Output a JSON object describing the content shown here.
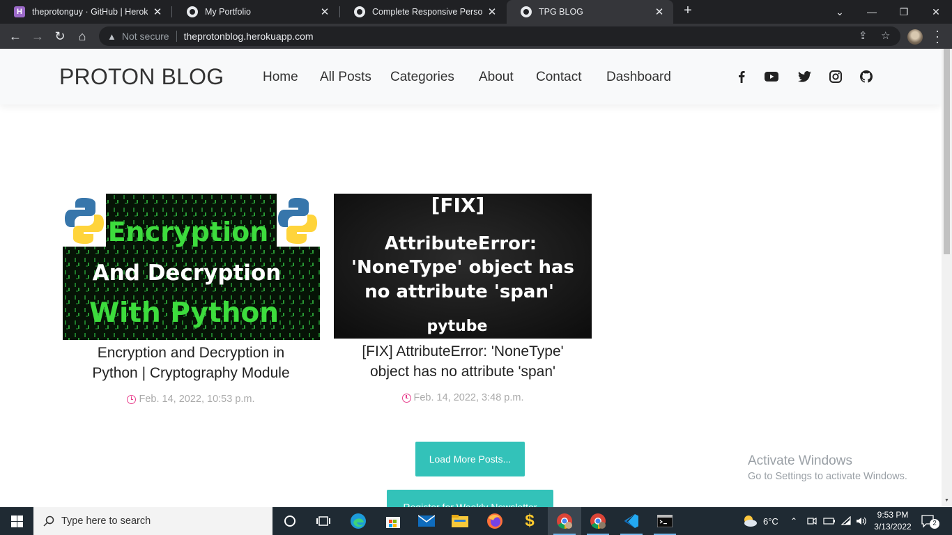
{
  "browser": {
    "tabs": [
      {
        "title": "theprotonguy · GitHub | Heroku",
        "favicon": "heroku-icon"
      },
      {
        "title": "My Portfolio",
        "favicon": "globe-icon"
      },
      {
        "title": "Complete Responsive Personal Po",
        "favicon": "globe-icon"
      },
      {
        "title": "TPG BLOG",
        "favicon": "globe-icon",
        "active": true
      }
    ],
    "security_label": "Not secure",
    "url": "theprotonblog.herokuapp.com"
  },
  "site": {
    "brand": "PROTON BLOG",
    "nav": [
      "Home",
      "All Posts",
      "Categories",
      "About",
      "Contact",
      "Dashboard"
    ],
    "social": [
      "facebook-icon",
      "youtube-icon",
      "twitter-icon",
      "instagram-icon",
      "github-icon"
    ]
  },
  "posts": [
    {
      "title_line1": "Encryption and Decryption in",
      "title_line2": "Python | Cryptography Module",
      "date": "Feb. 14, 2022, 10:53 p.m.",
      "image_text": [
        "Encryption",
        "And Decryption",
        "With Python"
      ]
    },
    {
      "title_line1": "[FIX] AttributeError: 'NoneType'",
      "title_line2": "object has no attribute 'span'",
      "date": "Feb. 14, 2022, 3:48 p.m.",
      "image_text": [
        "[FIX]",
        "AttributeError:",
        "'NoneType' object has",
        "no attribute 'span'",
        "pytube"
      ]
    }
  ],
  "buttons": {
    "load_more": "Load More Posts...",
    "newsletter": "Register for Weekly Newsletter"
  },
  "watermark": {
    "line1": "Activate Windows",
    "line2": "Go to Settings to activate Windows."
  },
  "taskbar": {
    "search_placeholder": "Type here to search",
    "weather": "6°C",
    "time": "9:53 PM",
    "date": "3/13/2022",
    "notifications": "2"
  },
  "colors": {
    "accent_teal": "#33c2b9",
    "date_icon_pink": "#e83e8c",
    "header_bg": "#f8f9fa"
  }
}
